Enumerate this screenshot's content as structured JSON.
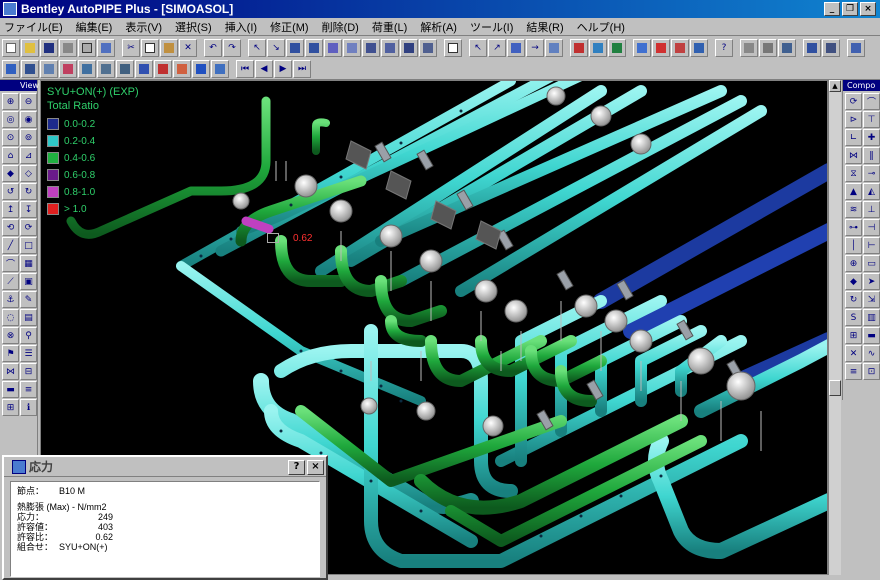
{
  "window": {
    "title": "Bentley AutoPIPE Plus - [SIMOASOL]",
    "controls": [
      "_",
      "❐",
      "×"
    ]
  },
  "menu": [
    "ファイル(E)",
    "編集(E)",
    "表示(V)",
    "選択(S)",
    "挿入(I)",
    "修正(M)",
    "削除(D)",
    "荷重(L)",
    "解析(A)",
    "ツール(I)",
    "結果(R)",
    "ヘルプ(H)"
  ],
  "panels": {
    "left_header": "View",
    "right_header": "Compo"
  },
  "viewport": {
    "header": "SYU+ON(+) (EXP)",
    "legend_title": "Total Ratio",
    "legend": [
      {
        "label": "0.0-0.2",
        "color": "#1c2a8c"
      },
      {
        "label": "0.2-0.4",
        "color": "#2fc8c8"
      },
      {
        "label": "0.4-0.6",
        "color": "#20b040"
      },
      {
        "label": "0.6-0.8",
        "color": "#6a1a8a"
      },
      {
        "label": "0.8-1.0",
        "color": "#c040c0"
      },
      {
        "label": "> 1.0",
        "color": "#e02020"
      }
    ],
    "callout_value": "0.62"
  },
  "colors": {
    "pipe_cyan": "#3fd6d0",
    "pipe_green": "#1fa83c",
    "pipe_blue": "#1c3aa0",
    "background": "#000000"
  },
  "dialog": {
    "title": "応力",
    "node_label": "節点：",
    "node_value": "B10 M",
    "section_title": "熱膨張 (Max) - N/mm2",
    "rows": [
      {
        "key": "応力：",
        "value": "249"
      },
      {
        "key": "許容値：",
        "value": "403"
      },
      {
        "key": "許容比：",
        "value": "0.62"
      }
    ],
    "combo_key": "組合せ：",
    "combo_value": "SYU+ON(+)",
    "buttons": [
      "?",
      "×"
    ]
  }
}
